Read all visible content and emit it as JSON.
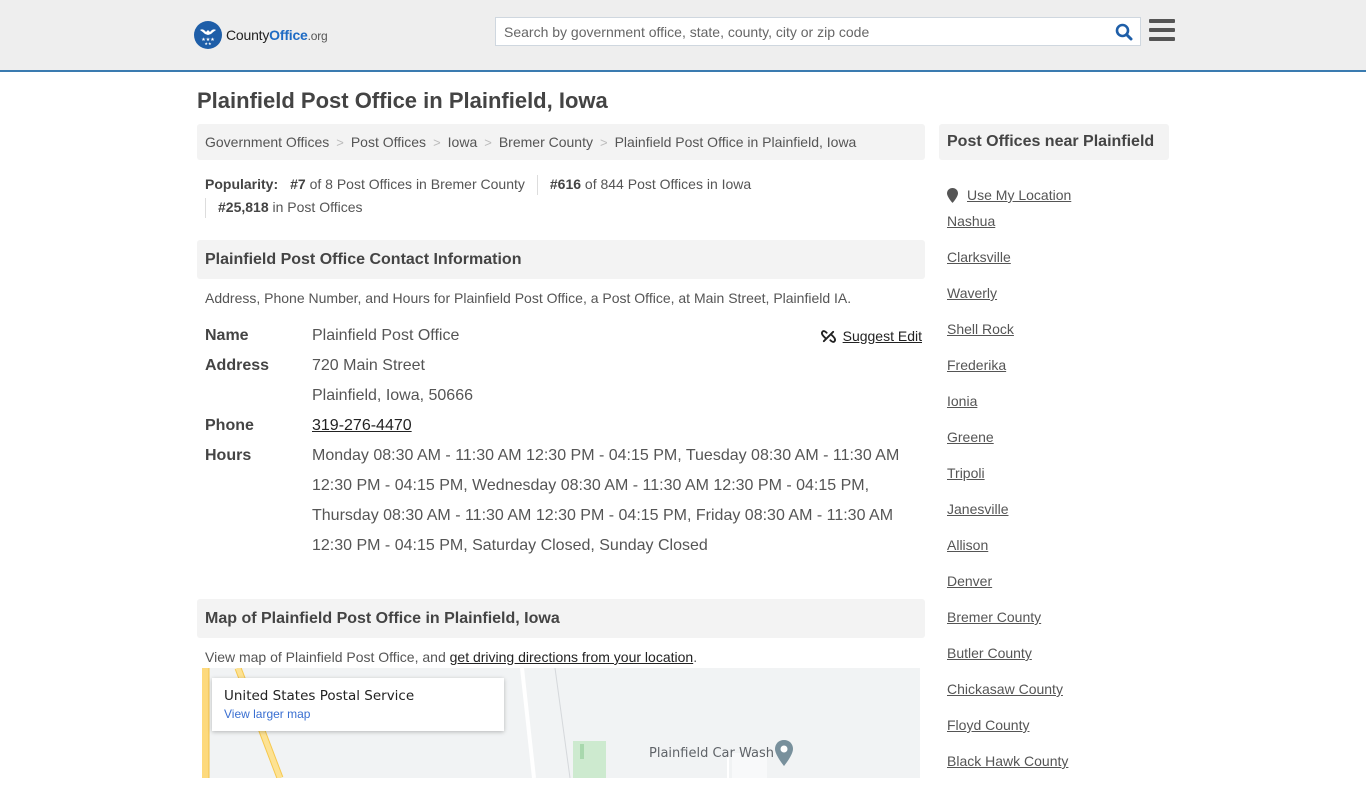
{
  "header": {
    "logo": {
      "prefix": "County",
      "brand": "Office",
      "tld": ".org"
    },
    "search": {
      "placeholder": "Search by government office, state, county, city or zip code",
      "value": ""
    },
    "icons": {
      "search": "search-icon",
      "menu": "hamburger-menu-icon"
    }
  },
  "page": {
    "title": "Plainfield Post Office in Plainfield, Iowa"
  },
  "breadcrumb": [
    {
      "label": "Government Offices"
    },
    {
      "label": "Post Offices"
    },
    {
      "label": "Iowa"
    },
    {
      "label": "Bremer County"
    },
    {
      "label": "Plainfield Post Office in Plainfield, Iowa"
    }
  ],
  "breadcrumb_separator": ">",
  "popularity": {
    "label": "Popularity:",
    "county_rank": "#7",
    "county_text": "of 8 Post Offices in Bremer County",
    "state_rank": "#616",
    "state_text": "of 844 Post Offices in Iowa",
    "national_rank": "#25,818",
    "national_text": "in Post Offices"
  },
  "contact": {
    "heading": "Plainfield Post Office Contact Information",
    "description": "Address, Phone Number, and Hours for Plainfield Post Office, a Post Office, at Main Street, Plainfield IA.",
    "suggest_edit": "Suggest Edit",
    "labels": {
      "name": "Name",
      "address": "Address",
      "phone": "Phone",
      "hours": "Hours"
    },
    "name": "Plainfield Post Office",
    "address_line1": "720 Main Street",
    "address_line2": "Plainfield, Iowa, 50666",
    "phone": "319-276-4470",
    "hours": "Monday 08:30 AM - 11:30 AM 12:30 PM - 04:15 PM, Tuesday 08:30 AM - 11:30 AM 12:30 PM - 04:15 PM, Wednesday 08:30 AM - 11:30 AM 12:30 PM - 04:15 PM, Thursday 08:30 AM - 11:30 AM 12:30 PM - 04:15 PM, Friday 08:30 AM - 11:30 AM 12:30 PM - 04:15 PM, Saturday Closed, Sunday Closed"
  },
  "map_section": {
    "heading": "Map of Plainfield Post Office in Plainfield, Iowa",
    "desc_prefix": "View map of Plainfield Post Office, and ",
    "desc_link": "get driving directions from your location",
    "desc_suffix": ".",
    "card_title": "United States Postal Service",
    "card_link": "View larger map",
    "poi_label": "Plainfield Car Wash"
  },
  "sidebar": {
    "heading": "Post Offices near Plainfield",
    "use_location": "Use My Location",
    "items": [
      "Nashua",
      "Clarksville",
      "Waverly",
      "Shell Rock",
      "Frederika",
      "Ionia",
      "Greene",
      "Tripoli",
      "Janesville",
      "Allison",
      "Denver",
      "Bremer County",
      "Butler County",
      "Chickasaw County",
      "Floyd County",
      "Black Hawk County"
    ]
  },
  "colors": {
    "header_bg": "#eeeeee",
    "header_border": "#3a7bb0",
    "brand_blue": "#1e5ea8",
    "section_bg": "#f3f3f3",
    "map_link": "#3a6fd1"
  }
}
